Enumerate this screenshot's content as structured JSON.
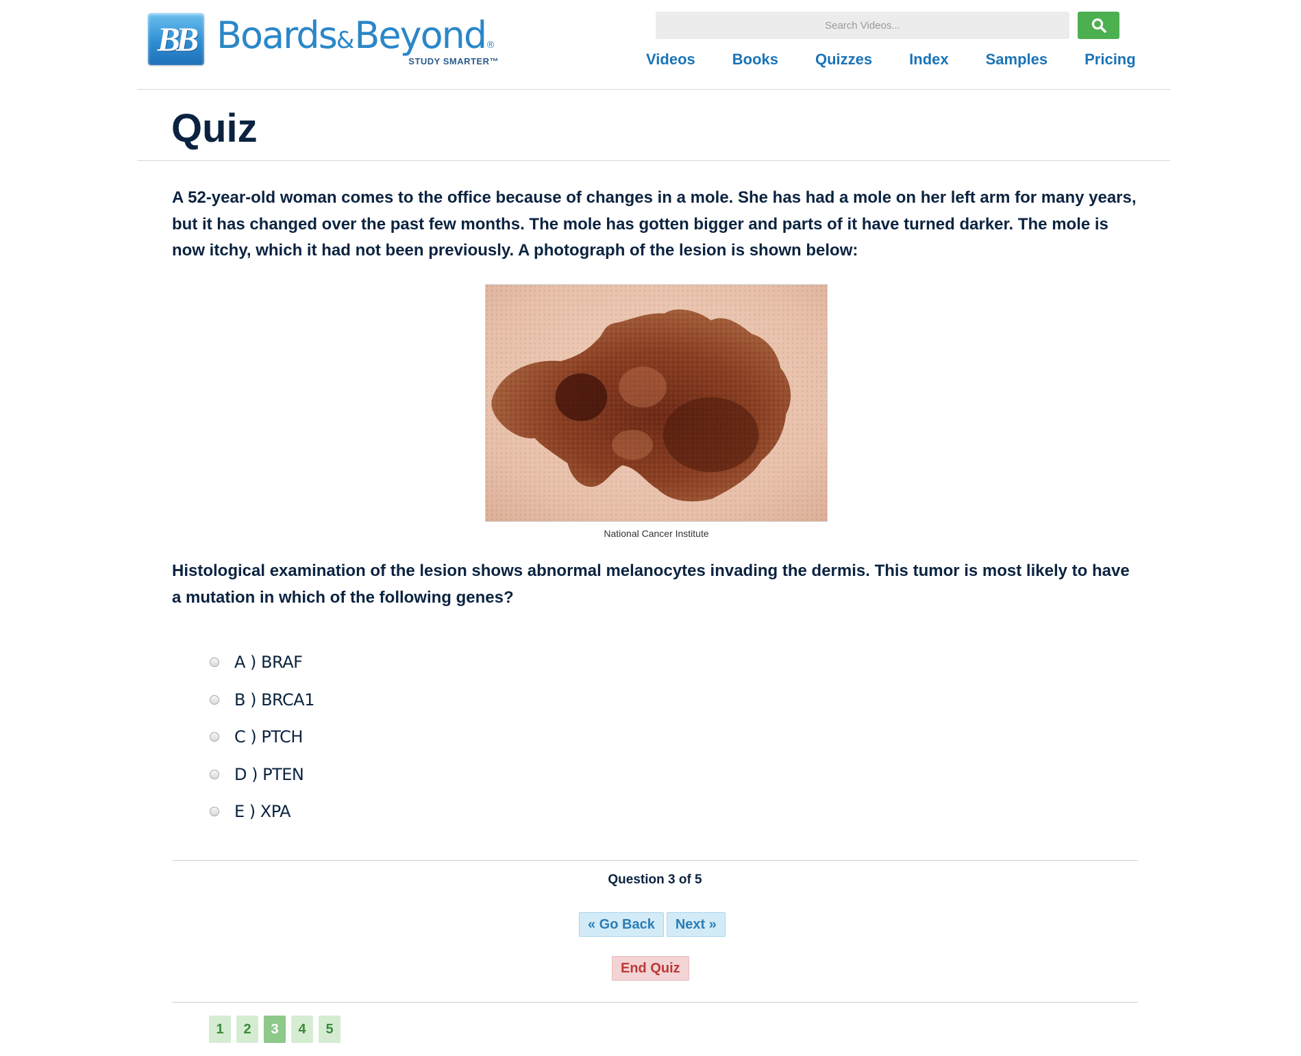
{
  "header": {
    "logo_badge": "BB",
    "logo_word_1": "Boards",
    "logo_amp": "&",
    "logo_word_2": "Beyond",
    "logo_registered": "®",
    "logo_tagline": "STUDY SMARTER™",
    "search_placeholder": "Search Videos...",
    "search_icon": "search-icon",
    "nav": [
      "Videos",
      "Books",
      "Quizzes",
      "Index",
      "Samples",
      "Pricing"
    ]
  },
  "page": {
    "title": "Quiz"
  },
  "question": {
    "stem": "A 52-year-old woman comes to the office because of changes in a mole. She has had a mole on her left arm for many years, but it has changed over the past few months. The mole has gotten bigger and parts of it have turned darker. The mole is now itchy, which it had not been previously. A photograph of the lesion is shown below:",
    "image_caption": "National Cancer Institute",
    "prompt": "Histological examination of the lesion shows abnormal melanocytes invading the dermis. This tumor is most likely to have a mutation in which of the following genes?",
    "options": [
      "A ) BRAF",
      "B ) BRCA1",
      "C ) PTCH",
      "D ) PTEN",
      "E ) XPA"
    ]
  },
  "footer": {
    "progress": "Question 3 of 5",
    "back_label": "« Go Back",
    "next_label": "Next »",
    "end_label": "End Quiz",
    "pages": [
      "1",
      "2",
      "3",
      "4",
      "5"
    ],
    "current_page": "3"
  },
  "colors": {
    "nav_blue": "#1a73b6",
    "title_navy": "#0b2340",
    "search_green": "#4caf50",
    "end_red": "#b83a3a"
  }
}
